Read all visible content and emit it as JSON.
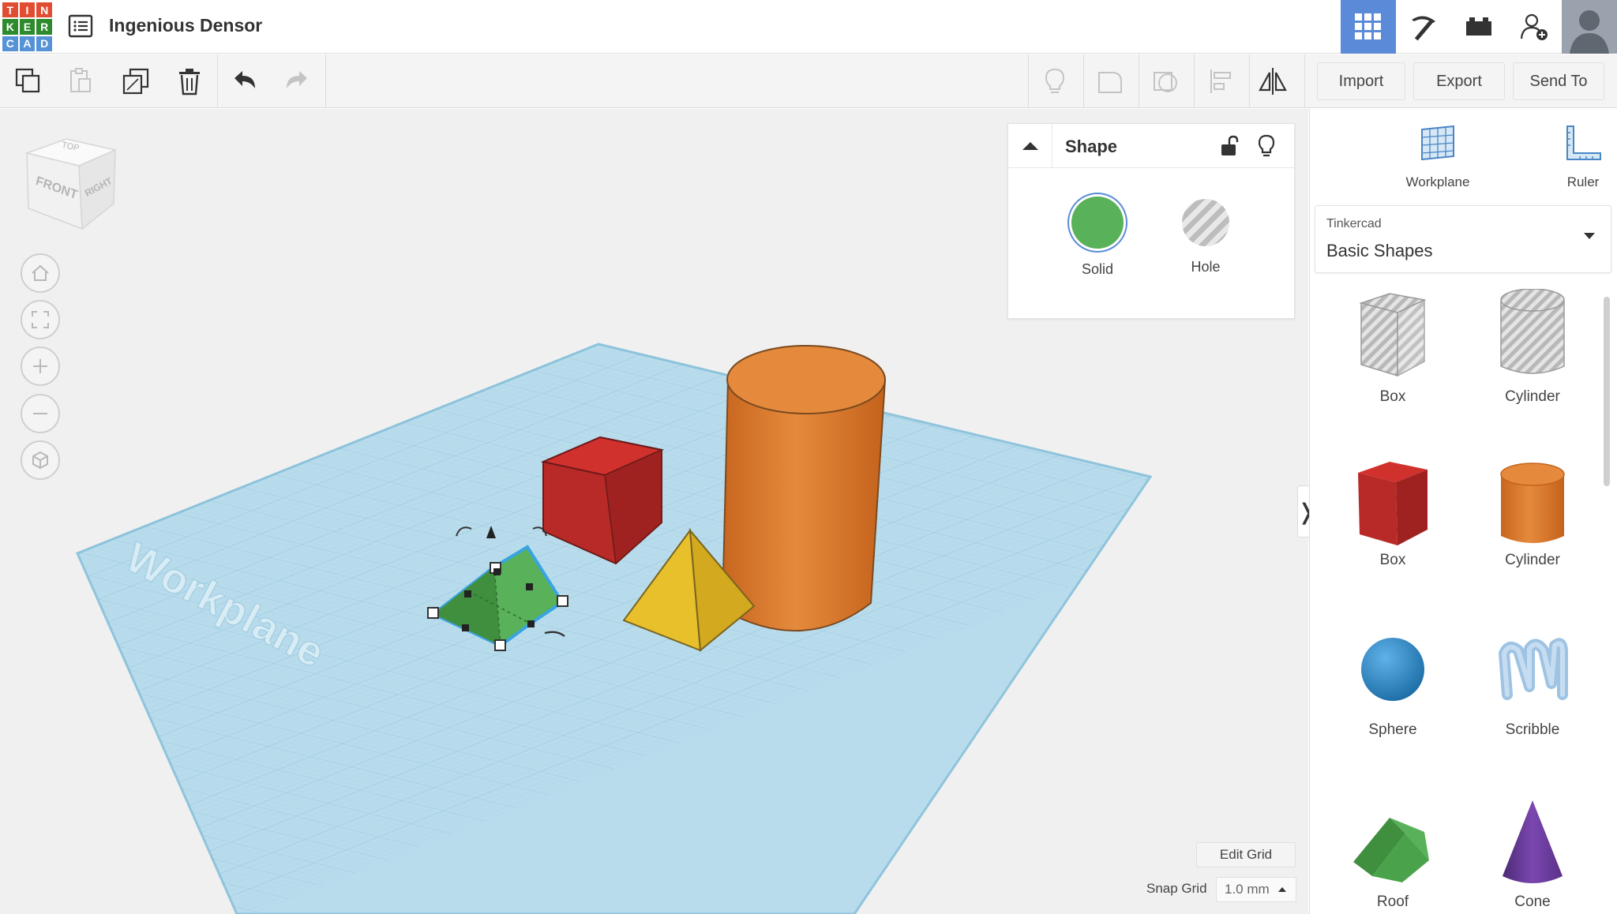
{
  "app": {
    "logo_letters": [
      "T",
      "I",
      "N",
      "K",
      "E",
      "R",
      "C",
      "A",
      "D"
    ],
    "logo_colors": [
      "#e14d32",
      "#e14d32",
      "#e14d32",
      "#2d8a2d",
      "#2d8a2d",
      "#2d8a2d",
      "#5592d6",
      "#5592d6",
      "#5592d6"
    ],
    "doc_title": "Ingenious Densor"
  },
  "topbar": {
    "buttons": [
      {
        "name": "3d-design-view-icon",
        "active": true
      },
      {
        "name": "pickaxe-icon",
        "active": false
      },
      {
        "name": "bricks-icon",
        "active": false
      },
      {
        "name": "add-user-icon",
        "active": false
      },
      {
        "name": "avatar",
        "active": false
      }
    ]
  },
  "toolbar": {
    "edit_icons": [
      "copy-icon",
      "paste-icon",
      "duplicate-icon",
      "delete-icon",
      "undo-icon",
      "redo-icon"
    ],
    "shape_icons": [
      "light-bulb-icon",
      "group-icon",
      "ungroup-icon",
      "align-icon",
      "mirror-icon"
    ],
    "import_label": "Import",
    "export_label": "Export",
    "sendto_label": "Send To"
  },
  "view_cube": {
    "top": "TOP",
    "front": "FRONT",
    "right": "RIGHT"
  },
  "view_controls": [
    "home-icon",
    "fit-view-icon",
    "zoom-in-icon",
    "zoom-out-icon",
    "orthographic-icon"
  ],
  "workplane_label": "Workplane",
  "shape_panel": {
    "title": "Shape",
    "solid_label": "Solid",
    "hole_label": "Hole",
    "solid_color": "#59b159"
  },
  "right_panel": {
    "tools": [
      {
        "label": "Workplane",
        "icon": "workplane-icon"
      },
      {
        "label": "Ruler",
        "icon": "ruler-icon"
      }
    ],
    "library_source": "Tinkercad",
    "library_name": "Basic Shapes",
    "shapes": [
      {
        "label": "Box",
        "kind": "box-hole"
      },
      {
        "label": "Cylinder",
        "kind": "cylinder-hole"
      },
      {
        "label": "Box",
        "kind": "box"
      },
      {
        "label": "Cylinder",
        "kind": "cylinder"
      },
      {
        "label": "Sphere",
        "kind": "sphere"
      },
      {
        "label": "Scribble",
        "kind": "scribble"
      },
      {
        "label": "Roof",
        "kind": "roof"
      },
      {
        "label": "Cone",
        "kind": "cone"
      }
    ]
  },
  "grid": {
    "edit_grid_label": "Edit Grid",
    "snap_grid_label": "Snap Grid",
    "snap_value": "1.0 mm"
  },
  "colors": {
    "accent": "#5b8bd8",
    "workplane": "#b9dcec",
    "red_box": "#d0312d",
    "orange_cylinder": "#e07a2c",
    "yellow_pyramid": "#f2ce3a",
    "green_roof": "#59b159"
  }
}
